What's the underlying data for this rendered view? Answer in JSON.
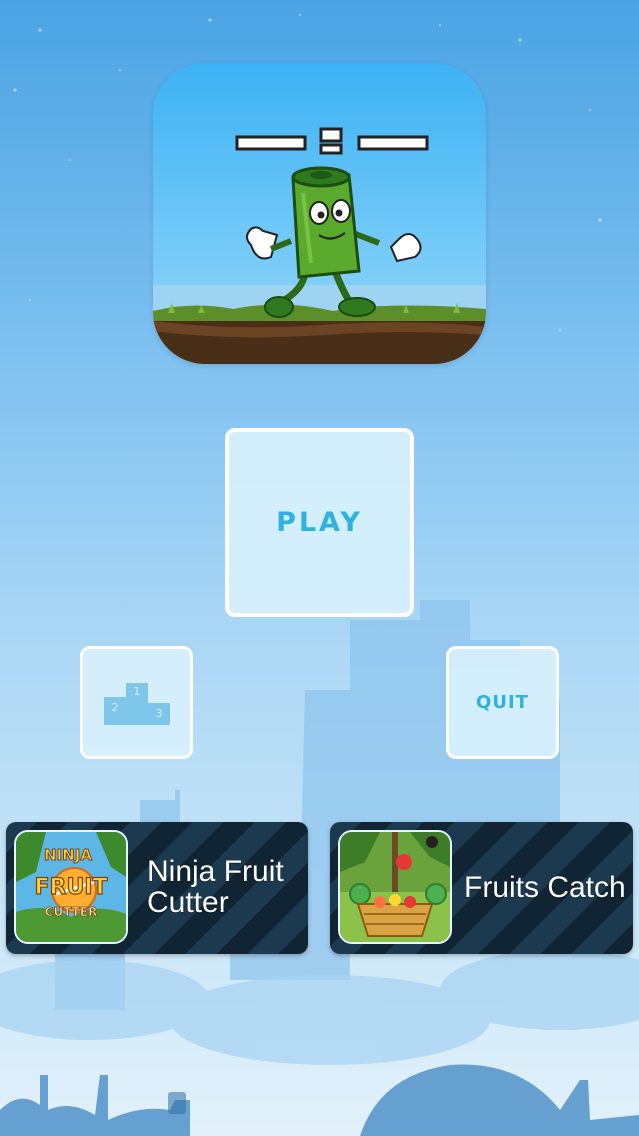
{
  "menu": {
    "play_label": "PLAY",
    "quit_label": "QUIT",
    "leaderboard_icon": "podium-icon",
    "podium_ranks": [
      "1",
      "2",
      "3"
    ]
  },
  "app_icon": "flying-battery-character-icon",
  "promos": [
    {
      "title": "Ninja Fruit Cutter",
      "thumb_text_top": "NINJA",
      "thumb_text_mid": "FRUIT",
      "thumb_text_bottom": "CUTTER"
    },
    {
      "title": "Fruits Catch"
    }
  ],
  "colors": {
    "accent": "#2fb2df",
    "sky_top": "#4aa3e3",
    "sky_bottom": "#e2f1fb",
    "promo_stripe_dark": "#102434",
    "promo_stripe_light": "#1c3a4f"
  }
}
